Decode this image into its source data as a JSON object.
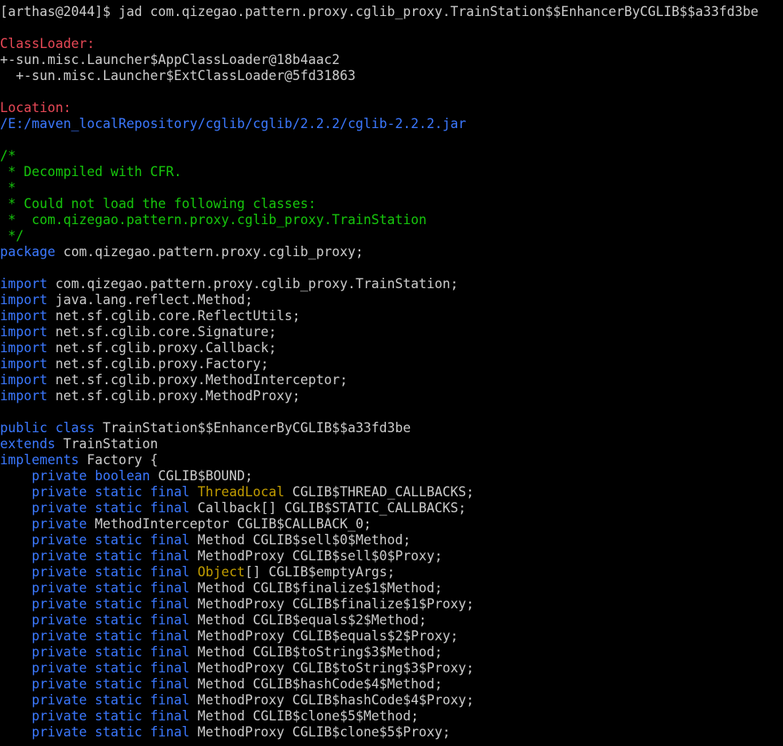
{
  "colors": {
    "background": "#000000",
    "default": "#cccccc",
    "red": "#e74856",
    "blue": "#3b78ff",
    "green": "#16c60c",
    "yellow": "#c19c00"
  },
  "lines": [
    [
      {
        "t": "[arthas@2044]$ jad com.qizegao.pattern.proxy.cglib_proxy.TrainStation$$EnhancerByCGLIB$$a33fd3be",
        "c": "default"
      }
    ],
    [],
    [
      {
        "t": "ClassLoader:",
        "c": "red"
      }
    ],
    [
      {
        "t": "+-sun.misc.Launcher$AppClassLoader@18b4aac2",
        "c": "default"
      }
    ],
    [
      {
        "t": "  +-sun.misc.Launcher$ExtClassLoader@5fd31863",
        "c": "default"
      }
    ],
    [],
    [
      {
        "t": "Location:",
        "c": "red"
      }
    ],
    [
      {
        "t": "/E:/maven_localRepository/cglib/cglib/2.2.2/cglib-2.2.2.jar",
        "c": "blue"
      }
    ],
    [],
    [
      {
        "t": "/*",
        "c": "green"
      }
    ],
    [
      {
        "t": " * Decompiled with CFR.",
        "c": "green"
      }
    ],
    [
      {
        "t": " *",
        "c": "green"
      }
    ],
    [
      {
        "t": " * Could not load the following classes:",
        "c": "green"
      }
    ],
    [
      {
        "t": " *  com.qizegao.pattern.proxy.cglib_proxy.TrainStation",
        "c": "green"
      }
    ],
    [
      {
        "t": " */",
        "c": "green"
      }
    ],
    [
      {
        "t": "package",
        "c": "blue"
      },
      {
        "t": " com.qizegao.pattern.proxy.cglib_proxy;",
        "c": "default"
      }
    ],
    [],
    [
      {
        "t": "import",
        "c": "blue"
      },
      {
        "t": " com.qizegao.pattern.proxy.cglib_proxy.TrainStation;",
        "c": "default"
      }
    ],
    [
      {
        "t": "import",
        "c": "blue"
      },
      {
        "t": " java.lang.reflect.Method;",
        "c": "default"
      }
    ],
    [
      {
        "t": "import",
        "c": "blue"
      },
      {
        "t": " net.sf.cglib.core.ReflectUtils;",
        "c": "default"
      }
    ],
    [
      {
        "t": "import",
        "c": "blue"
      },
      {
        "t": " net.sf.cglib.core.Signature;",
        "c": "default"
      }
    ],
    [
      {
        "t": "import",
        "c": "blue"
      },
      {
        "t": " net.sf.cglib.proxy.Callback;",
        "c": "default"
      }
    ],
    [
      {
        "t": "import",
        "c": "blue"
      },
      {
        "t": " net.sf.cglib.proxy.Factory;",
        "c": "default"
      }
    ],
    [
      {
        "t": "import",
        "c": "blue"
      },
      {
        "t": " net.sf.cglib.proxy.MethodInterceptor;",
        "c": "default"
      }
    ],
    [
      {
        "t": "import",
        "c": "blue"
      },
      {
        "t": " net.sf.cglib.proxy.MethodProxy;",
        "c": "default"
      }
    ],
    [],
    [
      {
        "t": "public class",
        "c": "blue"
      },
      {
        "t": " TrainStation$$EnhancerByCGLIB$$a33fd3be",
        "c": "default"
      }
    ],
    [
      {
        "t": "extends",
        "c": "blue"
      },
      {
        "t": " TrainStation",
        "c": "default"
      }
    ],
    [
      {
        "t": "implements",
        "c": "blue"
      },
      {
        "t": " Factory {",
        "c": "default"
      }
    ],
    [
      {
        "t": "    private boolean",
        "c": "blue"
      },
      {
        "t": " CGLIB$BOUND;",
        "c": "default"
      }
    ],
    [
      {
        "t": "    private static final",
        "c": "blue"
      },
      {
        "t": " ",
        "c": "default"
      },
      {
        "t": "ThreadLocal",
        "c": "yellow"
      },
      {
        "t": " CGLIB$THREAD_CALLBACKS;",
        "c": "default"
      }
    ],
    [
      {
        "t": "    private static final",
        "c": "blue"
      },
      {
        "t": " Callback[] CGLIB$STATIC_CALLBACKS;",
        "c": "default"
      }
    ],
    [
      {
        "t": "    private",
        "c": "blue"
      },
      {
        "t": " MethodInterceptor CGLIB$CALLBACK_0;",
        "c": "default"
      }
    ],
    [
      {
        "t": "    private static final",
        "c": "blue"
      },
      {
        "t": " Method CGLIB$sell$0$Method;",
        "c": "default"
      }
    ],
    [
      {
        "t": "    private static final",
        "c": "blue"
      },
      {
        "t": " MethodProxy CGLIB$sell$0$Proxy;",
        "c": "default"
      }
    ],
    [
      {
        "t": "    private static final",
        "c": "blue"
      },
      {
        "t": " ",
        "c": "default"
      },
      {
        "t": "Object",
        "c": "yellow"
      },
      {
        "t": "[] CGLIB$emptyArgs;",
        "c": "default"
      }
    ],
    [
      {
        "t": "    private static final",
        "c": "blue"
      },
      {
        "t": " Method CGLIB$finalize$1$Method;",
        "c": "default"
      }
    ],
    [
      {
        "t": "    private static final",
        "c": "blue"
      },
      {
        "t": " MethodProxy CGLIB$finalize$1$Proxy;",
        "c": "default"
      }
    ],
    [
      {
        "t": "    private static final",
        "c": "blue"
      },
      {
        "t": " Method CGLIB$equals$2$Method;",
        "c": "default"
      }
    ],
    [
      {
        "t": "    private static final",
        "c": "blue"
      },
      {
        "t": " MethodProxy CGLIB$equals$2$Proxy;",
        "c": "default"
      }
    ],
    [
      {
        "t": "    private static final",
        "c": "blue"
      },
      {
        "t": " Method CGLIB$toString$3$Method;",
        "c": "default"
      }
    ],
    [
      {
        "t": "    private static final",
        "c": "blue"
      },
      {
        "t": " MethodProxy CGLIB$toString$3$Proxy;",
        "c": "default"
      }
    ],
    [
      {
        "t": "    private static final",
        "c": "blue"
      },
      {
        "t": " Method CGLIB$hashCode$4$Method;",
        "c": "default"
      }
    ],
    [
      {
        "t": "    private static final",
        "c": "blue"
      },
      {
        "t": " MethodProxy CGLIB$hashCode$4$Proxy;",
        "c": "default"
      }
    ],
    [
      {
        "t": "    private static final",
        "c": "blue"
      },
      {
        "t": " Method CGLIB$clone$5$Method;",
        "c": "default"
      }
    ],
    [
      {
        "t": "    private static final",
        "c": "blue"
      },
      {
        "t": " MethodProxy CGLIB$clone$5$Proxy;",
        "c": "default"
      }
    ]
  ]
}
